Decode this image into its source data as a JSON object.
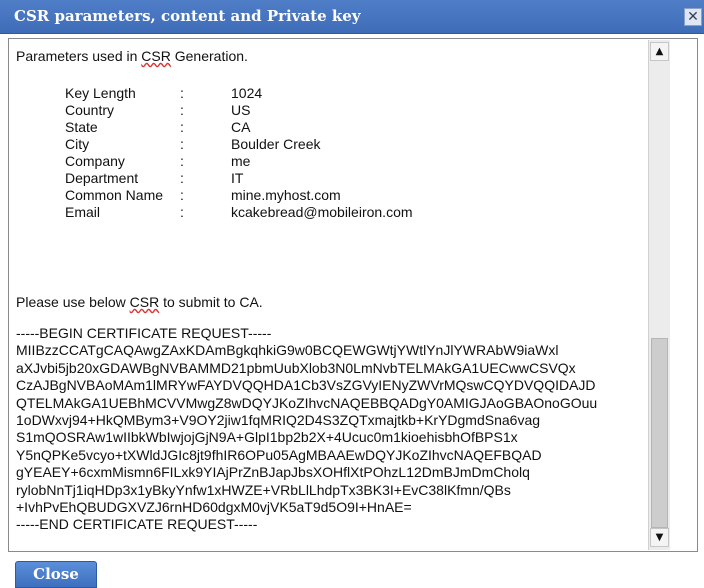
{
  "window": {
    "title": "CSR parameters, content and Private key",
    "close_glyph": "✕",
    "close_button_label": "Close"
  },
  "content": {
    "intro_prefix": "Parameters used in ",
    "intro_csr": "CSR",
    "intro_suffix": " Generation.",
    "params": [
      {
        "label": "Key Length",
        "value": "1024"
      },
      {
        "label": "Country",
        "value": "US"
      },
      {
        "label": "State",
        "value": "CA"
      },
      {
        "label": "City",
        "value": "Boulder Creek"
      },
      {
        "label": "Company",
        "value": "me"
      },
      {
        "label": "Department",
        "value": "IT"
      },
      {
        "label": "Common Name",
        "value": "mine.myhost.com"
      },
      {
        "label": "Email",
        "value": "kcakebread@mobileiron.com"
      }
    ],
    "colon": ":",
    "use_prefix": "Please use below ",
    "use_csr": "CSR",
    "use_suffix": " to submit to CA.",
    "cert_lines": [
      "-----BEGIN CERTIFICATE REQUEST-----",
      "MIIBzzCCATgCAQAwgZAxKDAmBgkqhkiG9w0BCQEWGWtjYWtlYnJlYWRAbW9iaWxl",
      "aXJvbi5jb20xGDAWBgNVBAMMD21pbmUubXlob3N0LmNvbTELMAkGA1UECwwCSVQx",
      "CzAJBgNVBAoMAm1lMRYwFAYDVQQHDA1Cb3VsZGVyIENyZWVrMQswCQYDVQQIDAJD",
      "QTELMAkGA1UEBhMCVVMwgZ8wDQYJKoZIhvcNAQEBBQADgY0AMIGJAoGBAOnoGOuu",
      "1oDWxvj94+HkQMBym3+V9OY2jiw1fqMRIQ2D4S3ZQTxmajtkb+KrYDgmdSna6vag",
      "S1mQOSRAw1wIIbkWbIwjojGjN9A+GlpI1bp2b2X+4Ucuc0m1kioehisbhOfBPS1x",
      "Y5nQPKe5vcyo+tXWldJGIc8jt9fhIR6OPu05AgMBAAEwDQYJKoZIhvcNAQEFBQAD",
      "gYEAEY+6cxmMismn6FILxk9YIAjPrZnBJapJbsXOHflXtPOhzL12DmBJmDmCholq",
      "rylobNnTj1iqHDp3x1yBkyYnfw1xHWZE+VRbLlLhdpTx3BK3I+EvC38lKfmn/QBs",
      "+IvhPvEhQBUDGXVZJ6rnHD60dgxM0vjVK5aT9d5O9I+HnAE=",
      "-----END CERTIFICATE REQUEST-----"
    ]
  }
}
